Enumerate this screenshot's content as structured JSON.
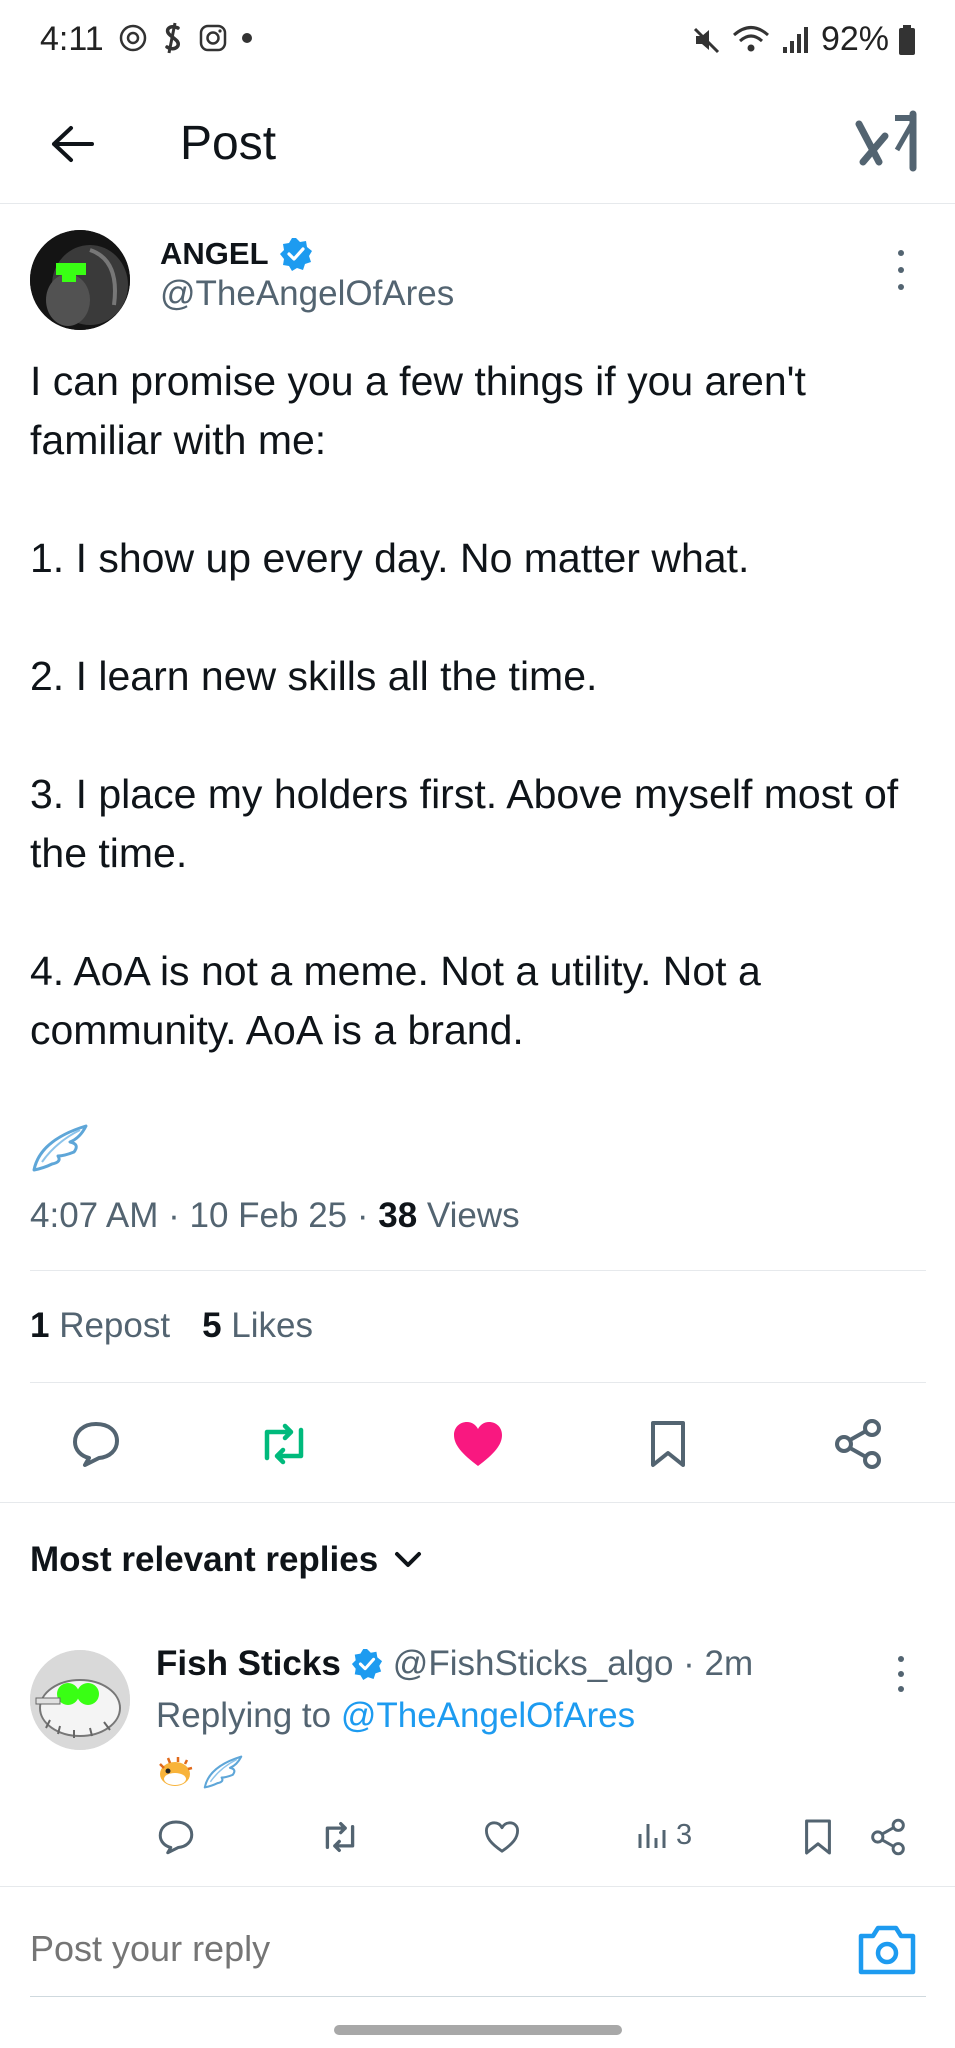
{
  "status_bar": {
    "time": "4:11",
    "battery": "92%",
    "icons": [
      "target-icon",
      "dollar-icon",
      "instagram-icon",
      "dot-icon",
      "mute-icon",
      "wifi-icon",
      "signal-icon",
      "battery-icon"
    ]
  },
  "header": {
    "title": "Post",
    "logo": "x-logo"
  },
  "post": {
    "author_name": "ANGEL",
    "author_handle": "@TheAngelOfAres",
    "verified": true,
    "text": "I can promise you a few things if you aren't familiar with me:\n\n1. I show up every day. No matter what.\n\n2. I learn new skills all the time.\n\n3. I place my holders first. Above myself most of the time.\n\n4. AoA is not a meme. Not a utility. Not a community. AoA is a brand.",
    "emoji": "wing-emoji",
    "timestamp": "4:07 AM · 10 Feb 25 · ",
    "views_count": "38",
    "views_label": " Views",
    "reposts_count": "1",
    "reposts_label": " Repost",
    "likes_count": "5",
    "likes_label": " Likes",
    "liked": true,
    "colors": {
      "like": "#f91880",
      "repost": "#00ba7c",
      "link": "#1d9bf0",
      "verified": "#1d9bf0"
    }
  },
  "replies_section": {
    "sort_label": "Most relevant replies"
  },
  "reply": {
    "name": "Fish Sticks",
    "handle": "@FishSticks_algo · 2m",
    "replying_prefix": "Replying to ",
    "replying_to": "@TheAngelOfAres",
    "emojis": [
      "pufferfish-emoji",
      "wing-emoji"
    ],
    "views": "3"
  },
  "composer": {
    "placeholder": "Post your reply"
  }
}
